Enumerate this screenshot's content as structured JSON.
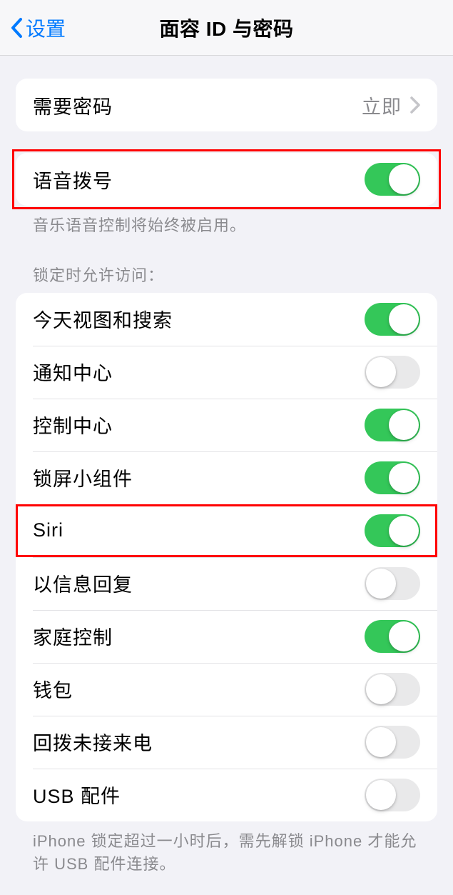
{
  "nav": {
    "back_label": "设置",
    "title": "面容 ID 与密码"
  },
  "require_passcode": {
    "label": "需要密码",
    "value": "立即"
  },
  "voice_dial": {
    "label": "语音拨号",
    "footer": "音乐语音控制将始终被启用。",
    "on": true
  },
  "locked_access": {
    "header": "锁定时允许访问：",
    "items": [
      {
        "label": "今天视图和搜索",
        "on": true
      },
      {
        "label": "通知中心",
        "on": false
      },
      {
        "label": "控制中心",
        "on": true
      },
      {
        "label": "锁屏小组件",
        "on": true
      },
      {
        "label": "Siri",
        "on": true
      },
      {
        "label": "以信息回复",
        "on": false
      },
      {
        "label": "家庭控制",
        "on": true
      },
      {
        "label": "钱包",
        "on": false
      },
      {
        "label": "回拨未接来电",
        "on": false
      },
      {
        "label": "USB 配件",
        "on": false
      }
    ],
    "footer": "iPhone 锁定超过一小时后，需先解锁 iPhone 才能允许 USB 配件连接。"
  }
}
